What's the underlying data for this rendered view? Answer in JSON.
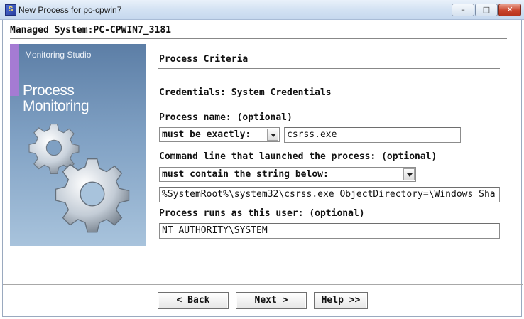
{
  "window": {
    "title": "New Process for pc-cpwin7",
    "app_icon": "app-icon",
    "controls": [
      "minimize-icon",
      "maximize-icon",
      "close-icon"
    ]
  },
  "header": {
    "managed_system": "Managed System:PC-CPWIN7_3181"
  },
  "banner": {
    "subtitle": "Monitoring Studio",
    "title_line1": "Process",
    "title_line2": "Monitoring",
    "graphic": "gears-icon",
    "accent_color": "#a57bd3"
  },
  "form": {
    "section_title": "Process Criteria",
    "credentials": "Credentials: System Credentials",
    "process_name_label": "Process name: (optional)",
    "process_name_operator": "must be exactly:",
    "process_name_value": "csrss.exe",
    "cmdline_label": "Command line that launched the process: (optional)",
    "cmdline_operator": "must contain the string below:",
    "cmdline_value": "%SystemRoot%\\system32\\csrss.exe ObjectDirectory=\\Windows Sha",
    "user_label": "Process runs as this user: (optional)",
    "user_value": "NT AUTHORITY\\SYSTEM"
  },
  "buttons": {
    "back": "< Back",
    "next": "Next >",
    "help": "Help >>"
  }
}
